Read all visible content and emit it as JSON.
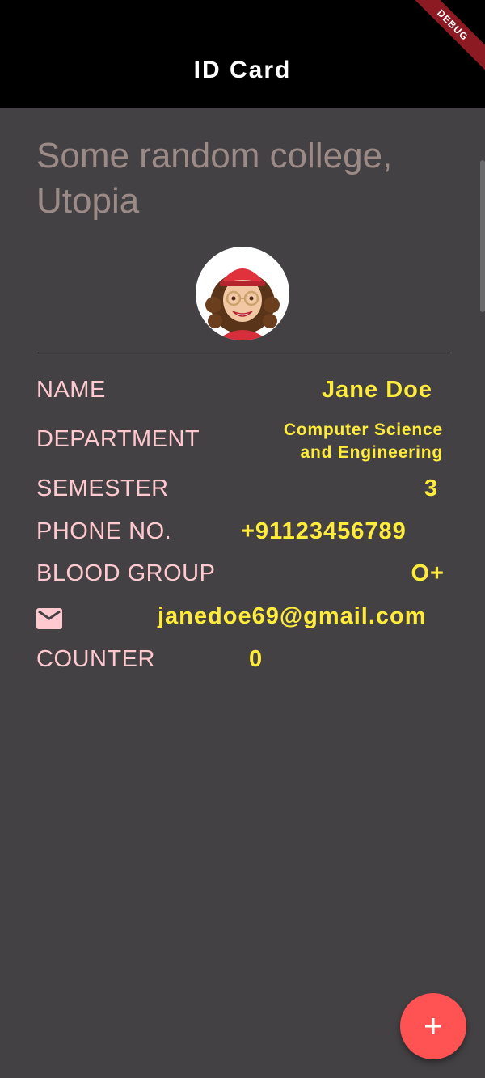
{
  "appbar": {
    "title": "ID Card",
    "debug_banner": "DEBUG"
  },
  "college": {
    "name": "Some random college, Utopia"
  },
  "avatar": {
    "icon": "avatar-illustration"
  },
  "details": {
    "name_label": "NAME",
    "name_value": "Jane Doe",
    "department_label": "DEPARTMENT",
    "department_value_line1": "Computer Science",
    "department_value_line2": "and Engineering",
    "semester_label": "SEMESTER",
    "semester_value": "3",
    "phone_label": "PHONE NO.",
    "phone_value": "+91123456789",
    "blood_label": "BLOOD GROUP",
    "blood_value": "O+",
    "email_icon": "mail-icon",
    "email_value": "janedoe69@gmail.com",
    "counter_label": "COUNTER",
    "counter_value": "0"
  },
  "fab": {
    "icon": "plus-icon"
  },
  "colors": {
    "background": "#434144",
    "appbar": "#000000",
    "label": "#ffc9cf",
    "value": "#ffeb3b",
    "college": "#9c8a86",
    "fab": "#ff5252"
  }
}
